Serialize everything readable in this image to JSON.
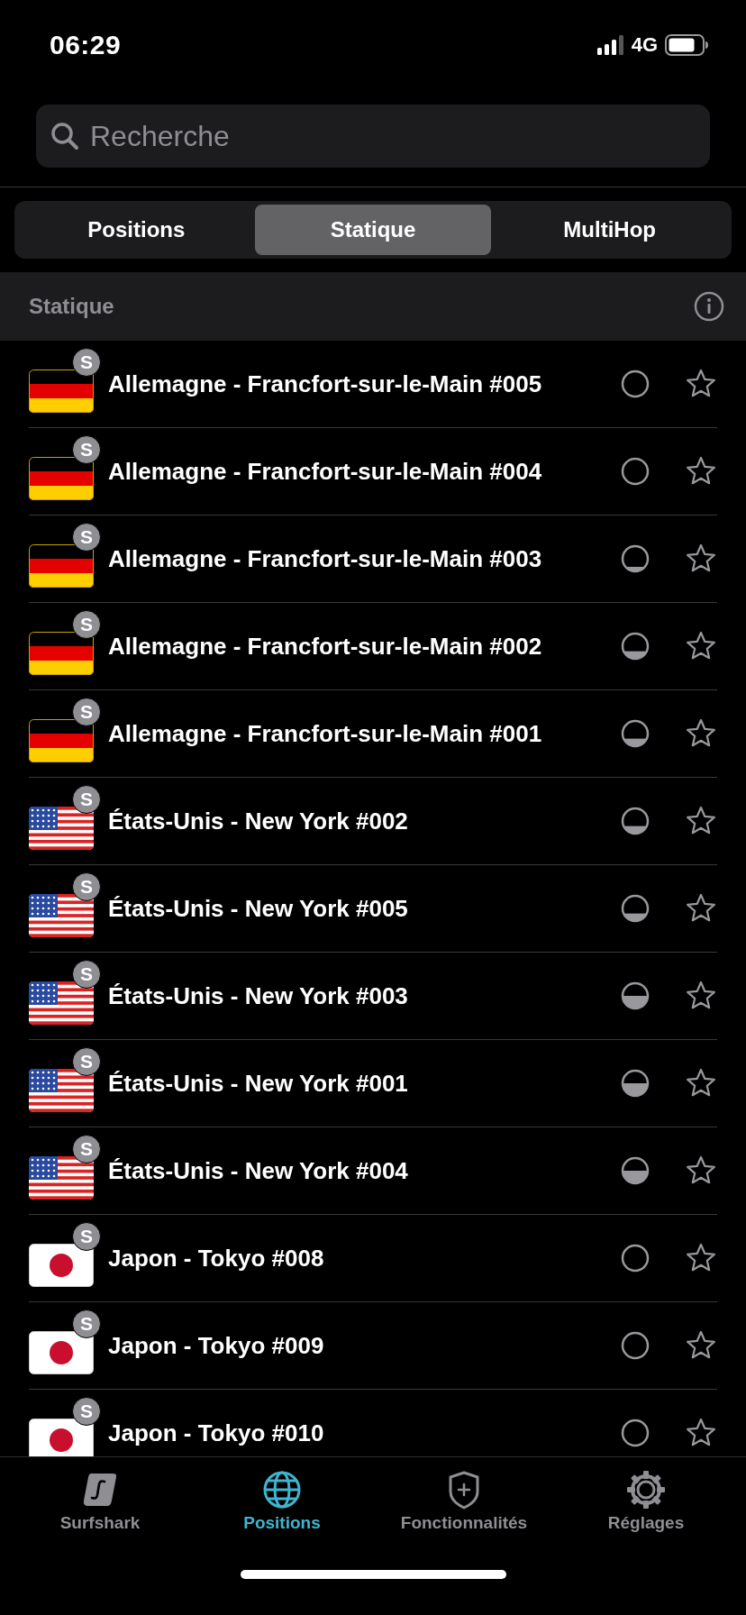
{
  "status_bar": {
    "time": "06:29",
    "network": "4G"
  },
  "search": {
    "placeholder": "Recherche"
  },
  "segments": [
    {
      "label": "Positions",
      "selected": false
    },
    {
      "label": "Statique",
      "selected": true
    },
    {
      "label": "MultiHop",
      "selected": false
    }
  ],
  "section": {
    "title": "Statique"
  },
  "servers": [
    {
      "kind": "de",
      "badge": "S",
      "name": "Allemagne - Francfort-sur-le-Main #005",
      "load": {
        "kind": "empty"
      },
      "favorite": false
    },
    {
      "kind": "de",
      "badge": "S",
      "name": "Allemagne - Francfort-sur-le-Main #004",
      "load": {
        "kind": "empty"
      },
      "favorite": false
    },
    {
      "kind": "de",
      "badge": "S",
      "name": "Allemagne - Francfort-sur-le-Main #003",
      "load": {
        "kind": "low"
      },
      "favorite": false
    },
    {
      "kind": "de",
      "badge": "S",
      "name": "Allemagne - Francfort-sur-le-Main #002",
      "load": {
        "kind": "mid"
      },
      "favorite": false
    },
    {
      "kind": "de",
      "badge": "S",
      "name": "Allemagne - Francfort-sur-le-Main #001",
      "load": {
        "kind": "mid"
      },
      "favorite": false
    },
    {
      "kind": "us",
      "badge": "S",
      "name": "États-Unis - New York #002",
      "load": {
        "kind": "mid"
      },
      "favorite": false
    },
    {
      "kind": "us",
      "badge": "S",
      "name": "États-Unis - New York #005",
      "load": {
        "kind": "mid"
      },
      "favorite": false
    },
    {
      "kind": "us",
      "badge": "S",
      "name": "États-Unis - New York #003",
      "load": {
        "kind": "high"
      },
      "favorite": false
    },
    {
      "kind": "us",
      "badge": "S",
      "name": "États-Unis - New York #001",
      "load": {
        "kind": "high"
      },
      "favorite": false
    },
    {
      "kind": "us",
      "badge": "S",
      "name": "États-Unis - New York #004",
      "load": {
        "kind": "high"
      },
      "favorite": false
    },
    {
      "kind": "jp",
      "badge": "S",
      "name": "Japon - Tokyo #008",
      "load": {
        "kind": "empty"
      },
      "favorite": false
    },
    {
      "kind": "jp",
      "badge": "S",
      "name": "Japon - Tokyo #009",
      "load": {
        "kind": "empty"
      },
      "favorite": false
    },
    {
      "kind": "jp",
      "badge": "S",
      "name": "Japon - Tokyo #010",
      "load": {
        "kind": "empty"
      },
      "favorite": false
    }
  ],
  "tab_bar": [
    {
      "kind": "logo",
      "label": "Surfshark",
      "selected": false
    },
    {
      "kind": "globe",
      "label": "Positions",
      "selected": true
    },
    {
      "kind": "shield",
      "label": "Fonctionnalités",
      "selected": false
    },
    {
      "kind": "gear",
      "label": "Réglages",
      "selected": false
    }
  ]
}
